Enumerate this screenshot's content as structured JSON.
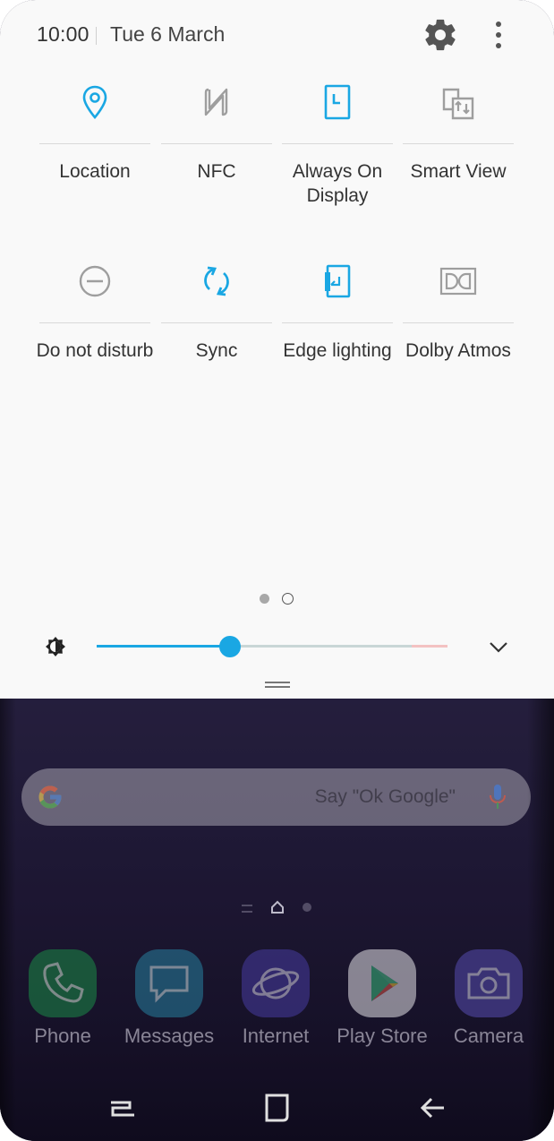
{
  "status": {
    "time": "10:00",
    "date": "Tue 6 March"
  },
  "tiles": [
    {
      "label": "Location",
      "icon": "location-icon",
      "active": true
    },
    {
      "label": "NFC",
      "icon": "nfc-icon",
      "active": false
    },
    {
      "label": "Always On Display",
      "icon": "always-on-display-icon",
      "active": true
    },
    {
      "label": "Smart View",
      "icon": "smart-view-icon",
      "active": false
    },
    {
      "label": "Do not disturb",
      "icon": "do-not-disturb-icon",
      "active": false
    },
    {
      "label": "Sync",
      "icon": "sync-icon",
      "active": true
    },
    {
      "label": "Edge lighting",
      "icon": "edge-lighting-icon",
      "active": true
    },
    {
      "label": "Dolby Atmos",
      "icon": "dolby-atmos-icon",
      "active": false
    }
  ],
  "pager": {
    "page_count": 2,
    "current_page": 1
  },
  "brightness": {
    "level": 0.38
  },
  "search": {
    "hint": "Say \"Ok Google\""
  },
  "dock": [
    {
      "label": "Phone",
      "icon": "phone-icon",
      "color": "#1f8f4e"
    },
    {
      "label": "Messages",
      "icon": "messages-icon",
      "color": "#2b84a6"
    },
    {
      "label": "Internet",
      "icon": "internet-icon",
      "color": "#4b3fa8"
    },
    {
      "label": "Play Store",
      "icon": "play-store-icon",
      "color": "#e9e7ef"
    },
    {
      "label": "Camera",
      "icon": "camera-icon",
      "color": "#5a50b8"
    }
  ],
  "colors": {
    "accent": "#1aa7e3",
    "inactive": "#9e9e9e",
    "panel_bg": "#f9f9f9"
  }
}
